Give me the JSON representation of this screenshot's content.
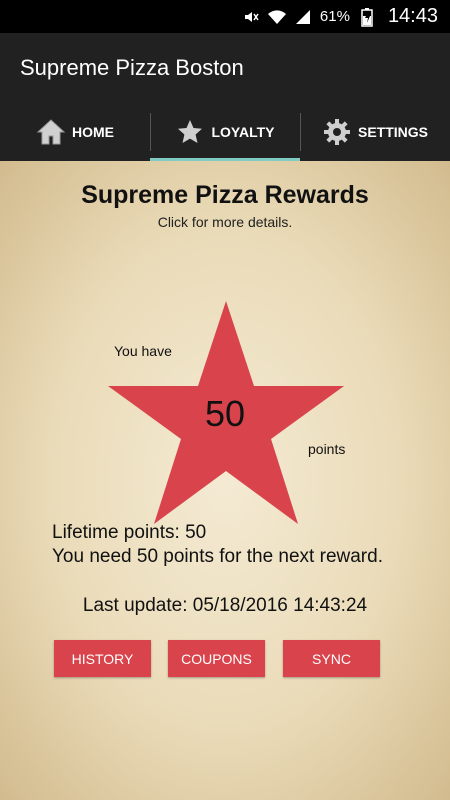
{
  "status_bar": {
    "battery": "61%",
    "time": "14:43"
  },
  "app_bar": {
    "title": "Supreme Pizza Boston"
  },
  "tabs": [
    {
      "label": "HOME",
      "icon": "home-icon"
    },
    {
      "label": "LOYALTY",
      "icon": "star-icon"
    },
    {
      "label": "SETTINGS",
      "icon": "gear-icon"
    }
  ],
  "rewards": {
    "title": "Supreme Pizza Rewards",
    "subtitle": "Click for more details.",
    "you_have": "You have",
    "points_value": "50",
    "points_label": "points",
    "lifetime": "Lifetime points: 50",
    "need": "You need 50 points for the next reward.",
    "last_update": "Last update: 05/18/2016 14:43:24"
  },
  "buttons": {
    "history": "HISTORY",
    "coupons": "COUPONS",
    "sync": "SYNC"
  },
  "colors": {
    "accent": "#d9434b",
    "tab_indicator": "#80cbc4",
    "app_bar": "#212121"
  }
}
